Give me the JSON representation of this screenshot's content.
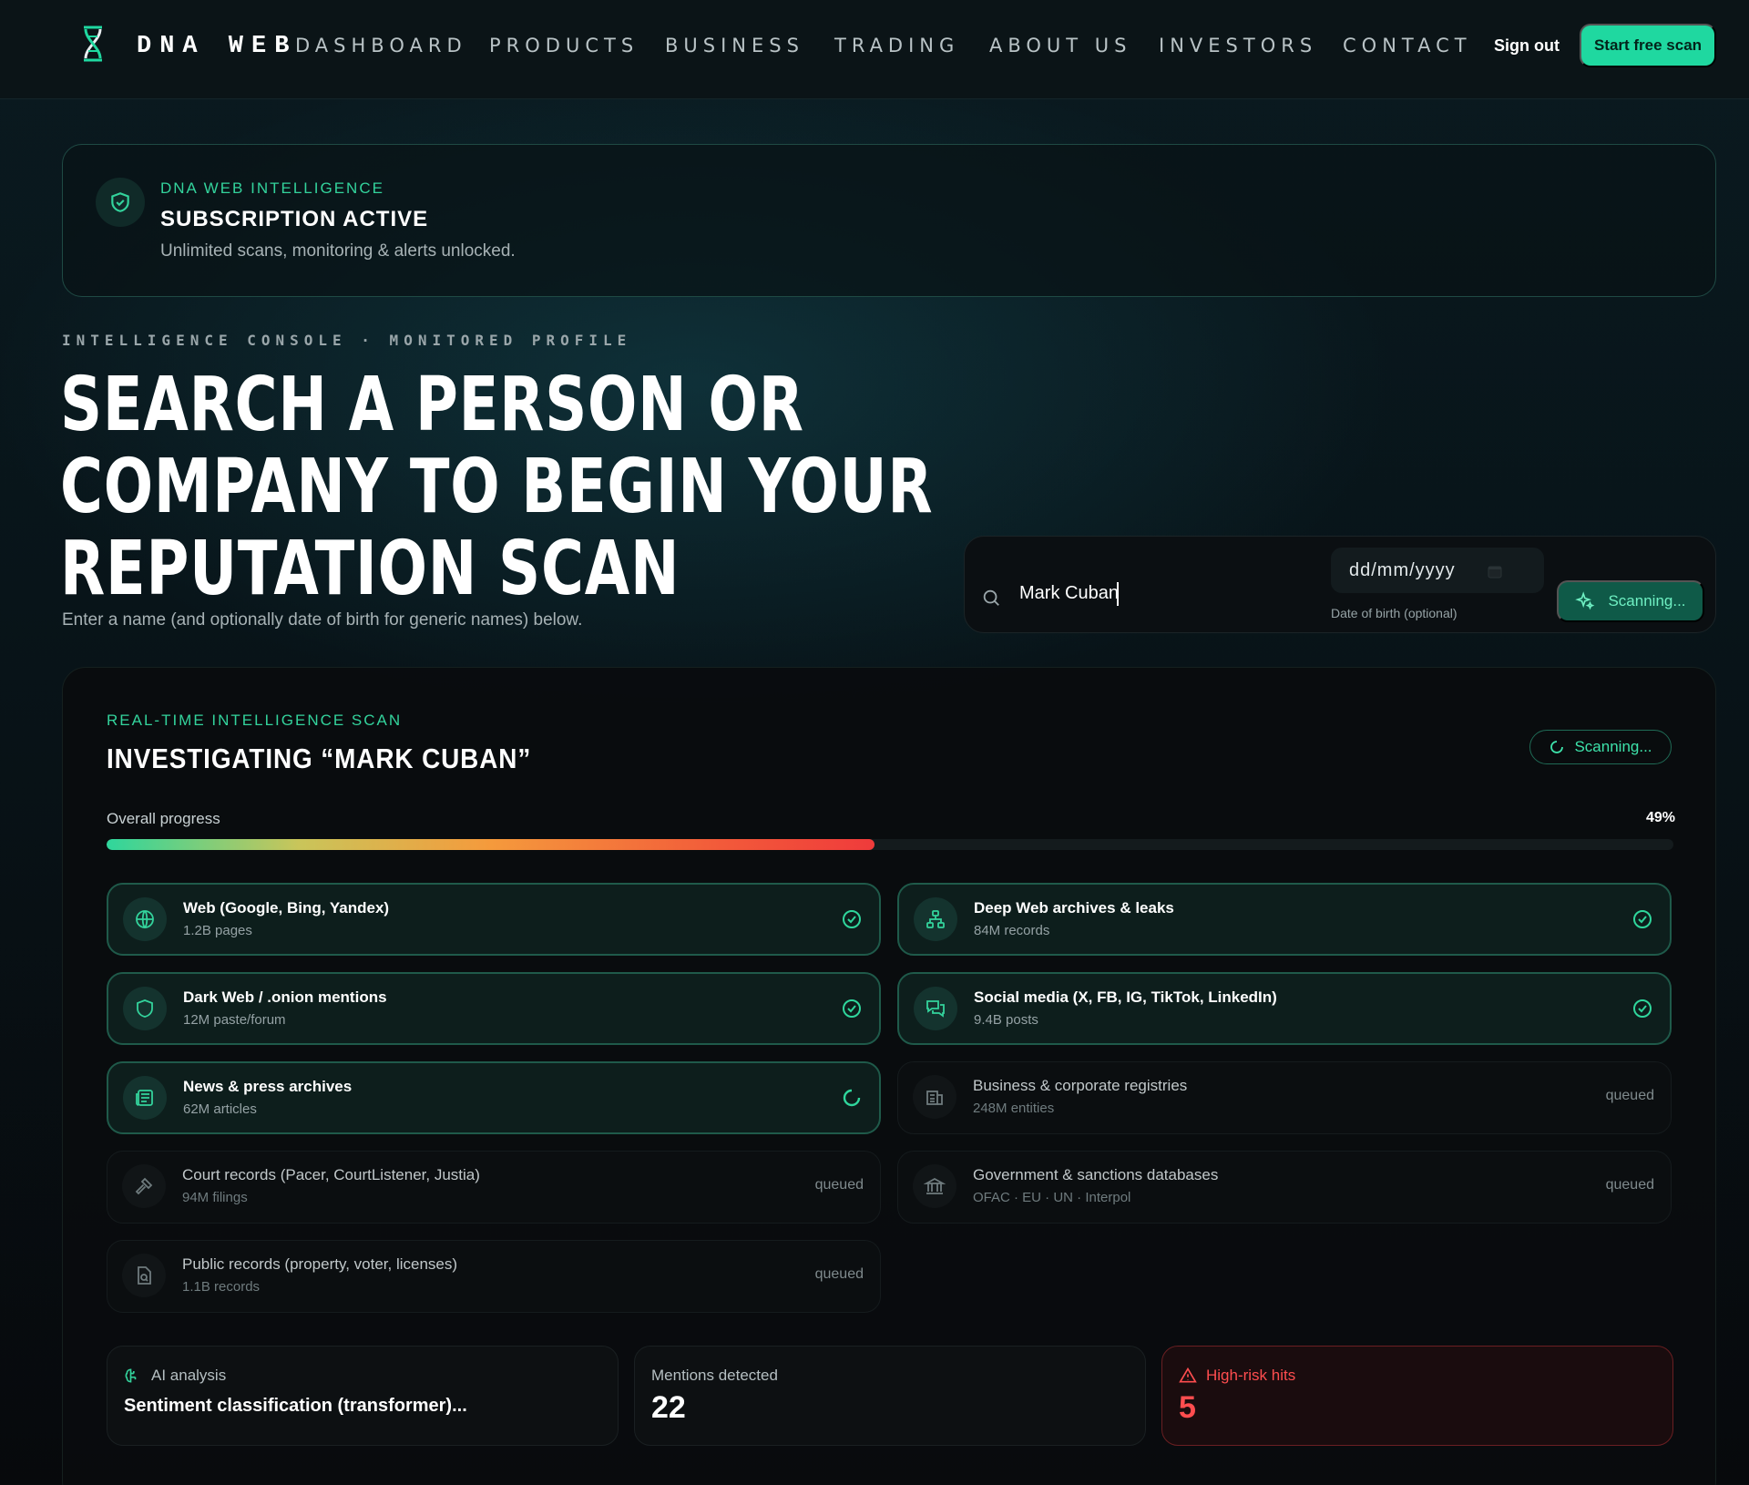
{
  "nav": {
    "brand": "DNA WEB",
    "links": [
      "DASHBOARD",
      "PRODUCTS",
      "BUSINESS",
      "TRADING",
      "ABOUT US",
      "INVESTORS",
      "CONTACT"
    ],
    "sign_out": "Sign out",
    "cta": "Start free scan"
  },
  "subscription": {
    "kicker": "DNA WEB INTELLIGENCE",
    "title": "SUBSCRIPTION ACTIVE",
    "description": "Unlimited scans, monitoring & alerts unlocked."
  },
  "hero": {
    "kicker": "INTELLIGENCE CONSOLE · MONITORED PROFILE",
    "title_lines": [
      "SEARCH A PERSON OR",
      "COMPANY TO BEGIN YOUR",
      "REPUTATION SCAN"
    ],
    "subtitle": "Enter a name (and optionally date of birth for generic names) below."
  },
  "search": {
    "query": "Mark Cuban",
    "date_placeholder": "dd/mm/yyyy",
    "date_label": "Date of birth (optional)",
    "button": "Scanning..."
  },
  "scan": {
    "kicker": "REAL-TIME INTELLIGENCE SCAN",
    "title": "INVESTIGATING “MARK CUBAN”",
    "status": "Scanning...",
    "progress_label": "Overall progress",
    "progress_percent": 49,
    "progress_text": "49%",
    "sources": [
      {
        "name": "Web (Google, Bing, Yandex)",
        "sub": "1.2B pages",
        "state": "done",
        "icon": "globe-icon"
      },
      {
        "name": "Deep Web archives & leaks",
        "sub": "84M records",
        "state": "done",
        "icon": "network-icon"
      },
      {
        "name": "Dark Web / .onion mentions",
        "sub": "12M paste/forum",
        "state": "done",
        "icon": "shield-icon"
      },
      {
        "name": "Social media (X, FB, IG, TikTok, LinkedIn)",
        "sub": "9.4B posts",
        "state": "done",
        "icon": "chat-icon"
      },
      {
        "name": "News & press archives",
        "sub": "62M articles",
        "state": "active",
        "icon": "newspaper-icon"
      },
      {
        "name": "Business & corporate registries",
        "sub": "248M entities",
        "state": "queued",
        "icon": "building-icon"
      },
      {
        "name": "Court records (Pacer, CourtListener, Justia)",
        "sub": "94M filings",
        "state": "queued",
        "icon": "gavel-icon"
      },
      {
        "name": "Government & sanctions databases",
        "sub": "OFAC · EU · UN · Interpol",
        "state": "queued",
        "icon": "landmark-icon"
      },
      {
        "name": "Public records (property, voter, licenses)",
        "sub": "1.1B records",
        "state": "queued",
        "icon": "file-search-icon"
      }
    ],
    "queued_label": "queued"
  },
  "stats": {
    "ai_label": "AI analysis",
    "ai_value": "Sentiment classification (transformer)...",
    "mentions_label": "Mentions detected",
    "mentions_value": "22",
    "risk_label": "High-risk hits",
    "risk_value": "5"
  },
  "colors": {
    "accent": "#1fd8a0",
    "risk": "#ff4d4f",
    "background": "#081419"
  }
}
